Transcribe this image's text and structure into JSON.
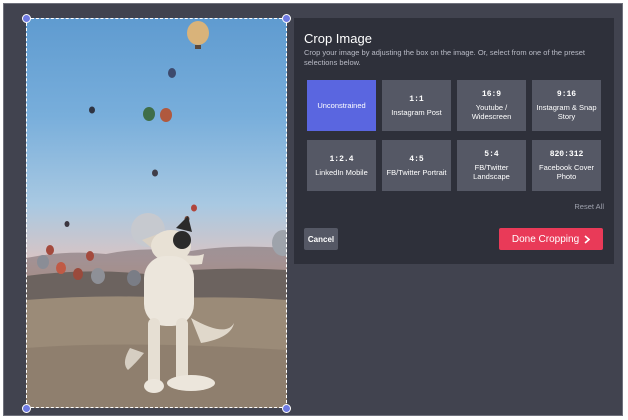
{
  "panel": {
    "title": "Crop Image",
    "description": "Crop your image by adjusting the box on the image. Or, select from one of the preset selections below.",
    "presets": [
      {
        "ratio": "",
        "name": "Unconstrained",
        "active": true
      },
      {
        "ratio": "1:1",
        "name": "Instagram Post"
      },
      {
        "ratio": "16:9",
        "name": "Youtube / Widescreen"
      },
      {
        "ratio": "9:16",
        "name": "Instagram & Snap Story"
      },
      {
        "ratio": "1:2.4",
        "name": "LinkedIn Mobile"
      },
      {
        "ratio": "4:5",
        "name": "FB/Twitter Portrait"
      },
      {
        "ratio": "5:4",
        "name": "FB/Twitter Landscape"
      },
      {
        "ratio": "820:312",
        "name": "Facebook Cover Photo"
      }
    ],
    "reset_label": "Reset All",
    "cancel_label": "Cancel",
    "done_label": "Done Cropping"
  },
  "colors": {
    "background": "#41434f",
    "panel": "#2e303a",
    "preset": "#555865",
    "active_preset": "#5a66e0",
    "done_button": "#e93a58",
    "handle": "#6f7be3"
  },
  "icons": {
    "done": "chevron-right-icon",
    "handles": "crop-handle"
  }
}
